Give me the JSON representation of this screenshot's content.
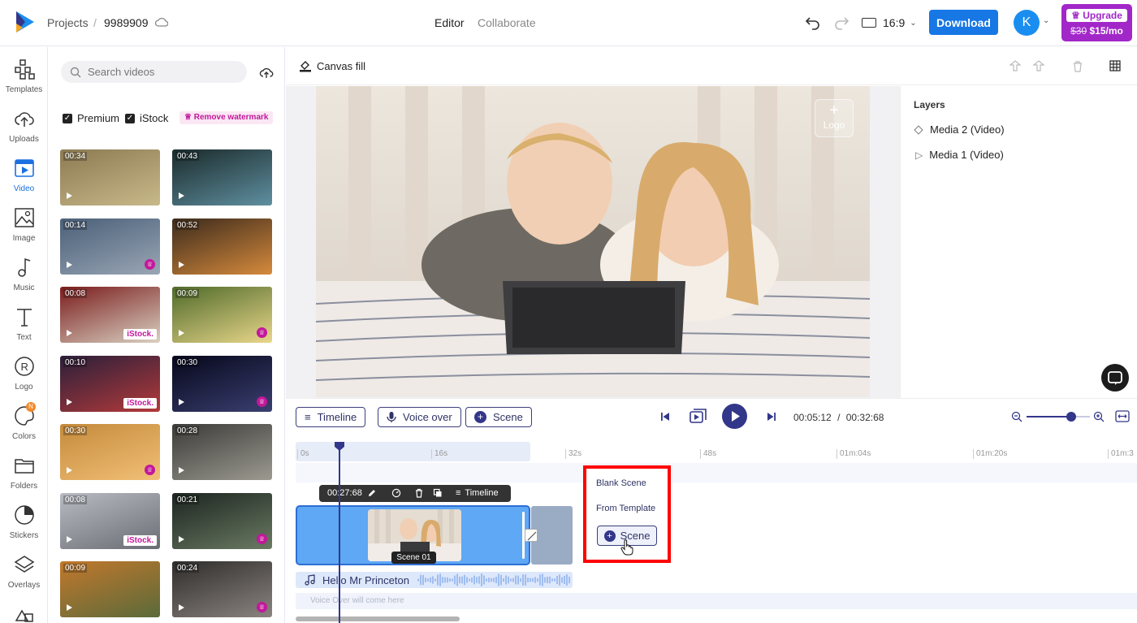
{
  "app": {
    "brand_color": "#1677e5",
    "accent": "#33378a"
  },
  "topbar": {
    "breadcrumb_root": "Projects",
    "breadcrumb_sep": "/",
    "project_name": "9989909",
    "tab_editor": "Editor",
    "tab_collaborate": "Collaborate",
    "aspect_ratio": "16:9",
    "download_label": "Download",
    "avatar_initial": "K",
    "upgrade_label": "Upgrade",
    "old_price": "$30",
    "new_price": "$15/mo"
  },
  "leftnav": [
    {
      "label": "Templates",
      "icon": "templates-icon"
    },
    {
      "label": "Uploads",
      "icon": "upload-cloud-icon"
    },
    {
      "label": "Video",
      "icon": "video-icon"
    },
    {
      "label": "Image",
      "icon": "image-icon"
    },
    {
      "label": "Music",
      "icon": "music-icon"
    },
    {
      "label": "Text",
      "icon": "text-icon"
    },
    {
      "label": "Logo",
      "icon": "logo-icon"
    },
    {
      "label": "Colors",
      "icon": "palette-icon",
      "badge": "N"
    },
    {
      "label": "Folders",
      "icon": "folder-icon"
    },
    {
      "label": "Stickers",
      "icon": "sticker-icon"
    },
    {
      "label": "Overlays",
      "icon": "layers-icon"
    }
  ],
  "panel": {
    "search_placeholder": "Search videos",
    "filter_premium": "Premium",
    "filter_istock": "iStock",
    "remove_watermark": "Remove watermark",
    "videos": [
      {
        "duration": "00:34",
        "badge": ""
      },
      {
        "duration": "00:43",
        "badge": ""
      },
      {
        "duration": "00:14",
        "badge": "crown"
      },
      {
        "duration": "00:52",
        "badge": ""
      },
      {
        "duration": "00:08",
        "badge": "iStock."
      },
      {
        "duration": "00:09",
        "badge": "crown"
      },
      {
        "duration": "00:10",
        "badge": "iStock."
      },
      {
        "duration": "00:30",
        "badge": "crown"
      },
      {
        "duration": "00:30",
        "badge": "crown"
      },
      {
        "duration": "00:28",
        "badge": ""
      },
      {
        "duration": "00:08",
        "badge": "iStock."
      },
      {
        "duration": "00:21",
        "badge": "crown"
      },
      {
        "duration": "00:09",
        "badge": ""
      },
      {
        "duration": "00:24",
        "badge": "crown"
      }
    ]
  },
  "canvas": {
    "fill_label": "Canvas fill",
    "logo_placeholder": "Logo"
  },
  "layers": {
    "title": "Layers",
    "items": [
      "Media 2 (Video)",
      "Media 1 (Video)"
    ]
  },
  "controls": {
    "timeline_label": "Timeline",
    "voiceover_label": "Voice over",
    "scene_label": "Scene",
    "current_time": "00:05:12",
    "time_sep": "/",
    "total_time": "00:32:68",
    "zoom_level": 0.7
  },
  "ruler": [
    "0s",
    "16s",
    "32s",
    "48s",
    "01m:04s",
    "01m:20s",
    "01m:3"
  ],
  "clip_toolbar": {
    "time": "00:27:68",
    "timeline_label": "Timeline"
  },
  "scene_clip": {
    "label": "Scene 01"
  },
  "audio_track": {
    "title": "Hello Mr Princeton"
  },
  "voice_track": {
    "placeholder": "Voice Over will come here"
  },
  "scene_menu": {
    "blank_scene": "Blank Scene",
    "from_template": "From Template",
    "scene_button": "Scene"
  }
}
